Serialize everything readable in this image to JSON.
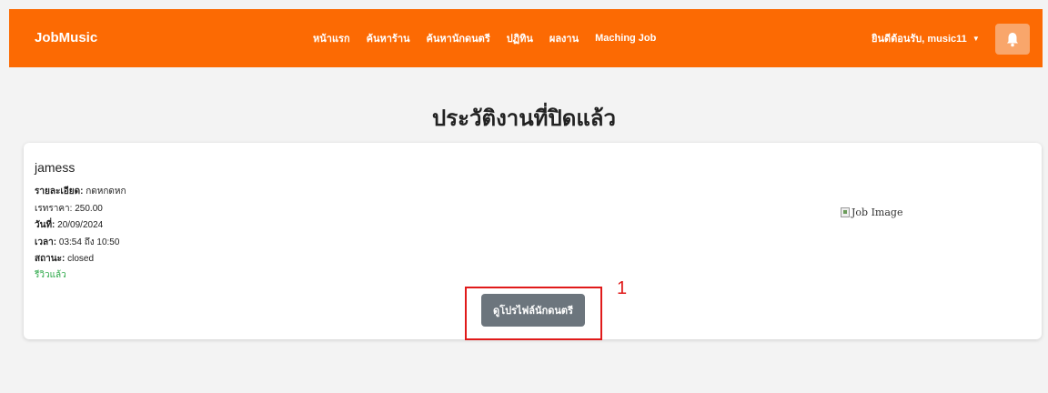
{
  "navbar": {
    "brand": "JobMusic",
    "links": [
      "หน้าแรก",
      "ค้นหาร้าน",
      "ค้นหานักดนตรี",
      "ปฏิทิน",
      "ผลงาน",
      "Maching Job"
    ],
    "user_menu": "ยินดีต้อนรับ, music11",
    "bell_icon": "bell-icon",
    "color": "#fc6a03"
  },
  "page": {
    "title": "ประวัติงานที่ปิดแล้ว"
  },
  "job": {
    "name": "jamess",
    "detail_label": "รายละเอียด:",
    "detail_value": "กดหกดหก",
    "price_label": "เรทราคา:",
    "price_value": "250.00",
    "date_label": "วันที่:",
    "date_value": "20/09/2024",
    "time_label": "เวลา:",
    "time_value": "03:54 ถึง 10:50",
    "status_label": "สถานะ:",
    "status_value": "closed",
    "review_status": "รีวิวแล้ว",
    "image_alt": "Job Image",
    "profile_button": "ดูโปรไฟล์นักดนตรี"
  },
  "annotation": {
    "label": "1"
  }
}
